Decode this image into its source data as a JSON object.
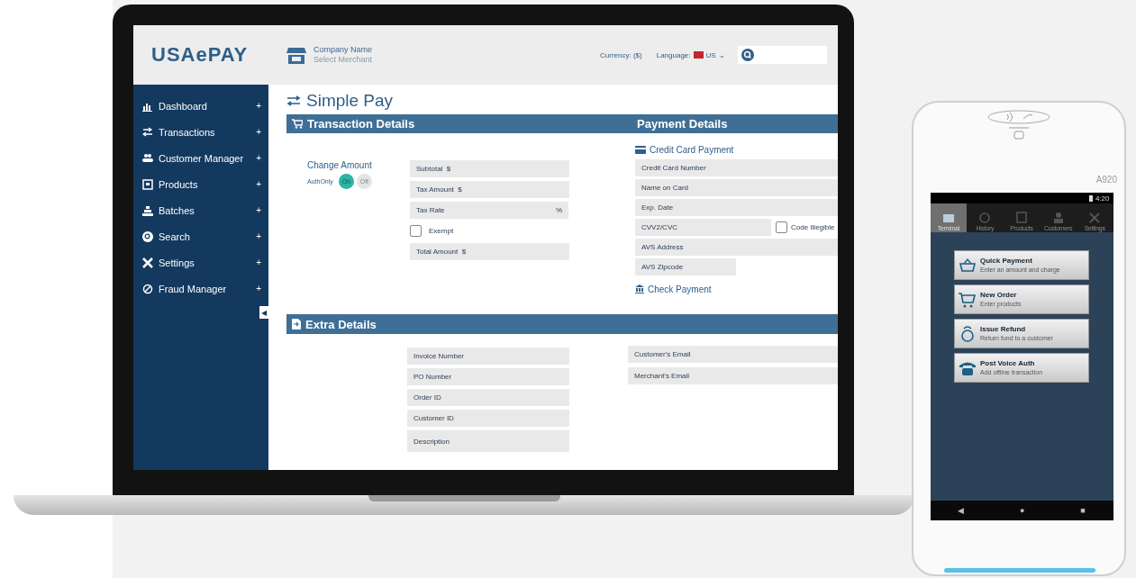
{
  "laptop": {
    "header": {
      "logo": "USAePAY",
      "company_name": "Company Name",
      "merchant": "Select Merchant",
      "currency": "Currency: ($)",
      "language_label": "Language:",
      "language": "US",
      "language_caret": "⌄"
    },
    "sidebar": {
      "items": [
        {
          "label": "Dashboard",
          "toggle": "+"
        },
        {
          "label": "Transactions",
          "toggle": "+"
        },
        {
          "label": "Customer Manager",
          "toggle": "+"
        },
        {
          "label": "Products",
          "toggle": "+"
        },
        {
          "label": "Batches",
          "toggle": "+"
        },
        {
          "label": "Search",
          "toggle": "+"
        },
        {
          "label": "Settings",
          "toggle": "+"
        },
        {
          "label": "Fraud Manager",
          "toggle": "+"
        }
      ],
      "collapse_button": "◀"
    },
    "page_title": "Simple Pay",
    "transaction_details": {
      "title": "Transaction Details",
      "change_amount": {
        "label": "Change Amount",
        "mode_label": "AuthOnly",
        "options": [
          {
            "label": "On",
            "selected": true
          },
          {
            "label": "Off",
            "selected": false
          }
        ]
      },
      "fields": [
        {
          "kind": "field",
          "placeholder": "Subtotal  $"
        },
        {
          "kind": "field",
          "placeholder": "Tax Amount  $"
        },
        {
          "kind": "suffix",
          "placeholder": "Tax Rate",
          "suffix": "%"
        },
        {
          "kind": "checkbox",
          "label": "Exempt",
          "checked": false
        },
        {
          "kind": "field",
          "placeholder": "Total Amount  $"
        }
      ]
    },
    "payment_details": {
      "title": "Payment Details",
      "credit_card": "Credit Card Payment",
      "fields": [
        {
          "kind": "field",
          "placeholder": "Credit Card Number"
        },
        {
          "kind": "field",
          "placeholder": "Name on Card"
        },
        {
          "kind": "field",
          "placeholder": "Exp. Date"
        },
        {
          "kind": "field_checkbox",
          "placeholder": "CVV2/CVC",
          "label": "Code Illegible",
          "checked": false
        },
        {
          "kind": "field",
          "placeholder": "AVS Address"
        },
        {
          "kind": "short",
          "placeholder": "AVS Zipcode"
        }
      ],
      "check_payment": "Check Payment"
    },
    "extra_details": {
      "title": "Extra Details",
      "left_fields": [
        {
          "placeholder": "Invoice Number",
          "tall": false
        },
        {
          "placeholder": "PO Number",
          "tall": false
        },
        {
          "placeholder": "Order ID",
          "tall": false
        },
        {
          "placeholder": "Customer ID",
          "tall": false
        },
        {
          "placeholder": "Description",
          "tall": true
        }
      ],
      "right_fields": [
        {
          "placeholder": "Customer's Email"
        },
        {
          "placeholder": "Merchant's Email"
        }
      ]
    }
  },
  "phone": {
    "model": "A920",
    "status_time": "4:20",
    "tabs": [
      {
        "label": "Terminal",
        "selected": true
      },
      {
        "label": "History",
        "selected": false
      },
      {
        "label": "Products",
        "selected": false
      },
      {
        "label": "Customers",
        "selected": false
      },
      {
        "label": "Settings",
        "selected": false
      }
    ],
    "actions": [
      {
        "title": "Quick Payment",
        "subtitle": "Enter an amount and charge"
      },
      {
        "title": "New Order",
        "subtitle": "Enter products"
      },
      {
        "title": "Issue Refund",
        "subtitle": "Return fund to a customer"
      },
      {
        "title": "Post Voice Auth",
        "subtitle": "Add offline transaction"
      }
    ],
    "nav": [
      "◀",
      "●",
      "■"
    ]
  }
}
